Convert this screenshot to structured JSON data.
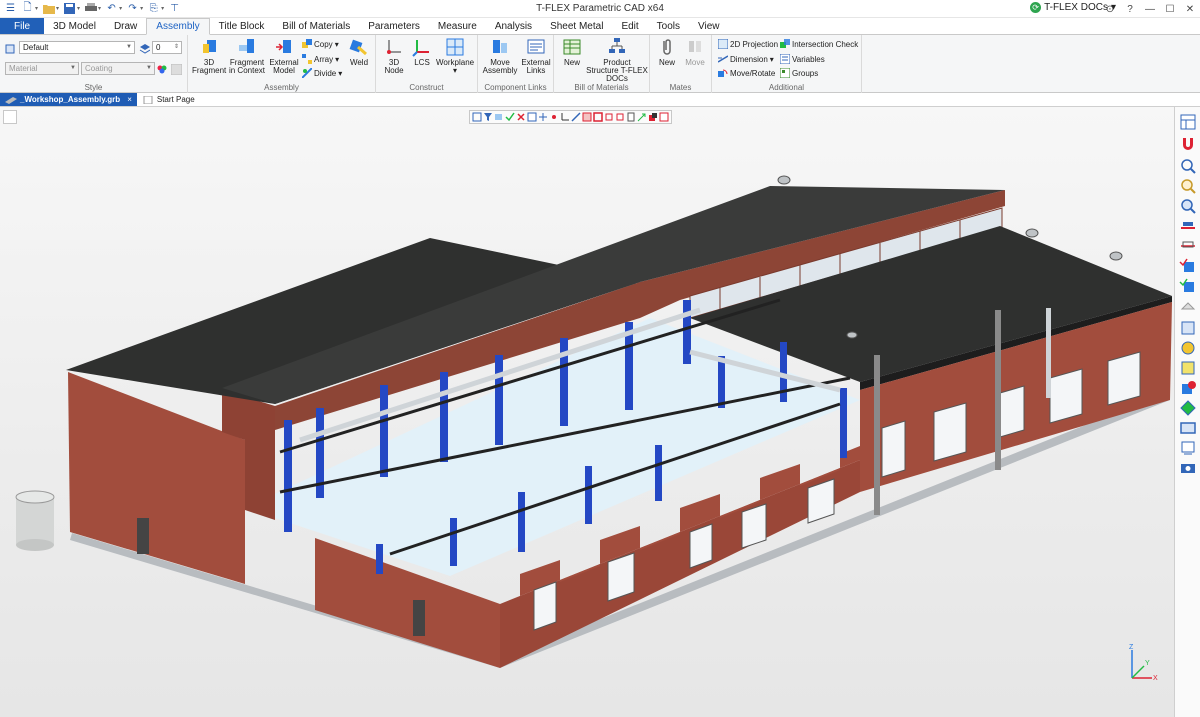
{
  "window": {
    "title": "T-FLEX Parametric CAD x64",
    "docs_label": "T-FLEX DOCs",
    "docs_dropdown": "▾"
  },
  "quick_access": [
    "menu-icon",
    "new-doc-icon",
    "open-icon",
    "save-icon",
    "print-icon",
    "undo-icon",
    "redo-icon",
    "export-icon"
  ],
  "window_buttons": {
    "minimize": "—",
    "maximize": "☐",
    "close": "✕",
    "help": "?",
    "options": "⊙"
  },
  "tabs": [
    {
      "label": "File"
    },
    {
      "label": "3D Model"
    },
    {
      "label": "Draw"
    },
    {
      "label": "Assembly"
    },
    {
      "label": "Title Block"
    },
    {
      "label": "Bill of Materials"
    },
    {
      "label": "Parameters"
    },
    {
      "label": "Measure"
    },
    {
      "label": "Analysis"
    },
    {
      "label": "Sheet Metal"
    },
    {
      "label": "Edit"
    },
    {
      "label": "Tools"
    },
    {
      "label": "View"
    }
  ],
  "ribbon": {
    "style": {
      "label": "Style",
      "style_value": "Default",
      "layer_value": "0",
      "material_placeholder": "Material",
      "coating_placeholder": "Coating"
    },
    "assembly": {
      "label": "Assembly",
      "fragment": "3D Fragment",
      "in_context": "Fragment in Context",
      "external": "External Model",
      "copy": "Copy",
      "array": "Array",
      "divide": "Divide",
      "weld": "Weld"
    },
    "construct": {
      "label": "Construct",
      "node": "3D Node",
      "lcs": "LCS",
      "workplane": "Workplane"
    },
    "component_links": {
      "label": "Component Links",
      "move_assembly": "Move Assembly",
      "external_links": "External Links"
    },
    "bom": {
      "label": "Bill of Materials",
      "new": "New",
      "product_structure": "Product Structure T-FLEX DOCs"
    },
    "mates": {
      "label": "Mates",
      "new": "New",
      "move": "Move"
    },
    "additional": {
      "label": "Additional",
      "projection": "2D Projection",
      "dimension": "Dimension",
      "move_rotate": "Move/Rotate",
      "intersection": "Intersection Check",
      "variables": "Variables",
      "groups": "Groups"
    }
  },
  "documents": [
    {
      "label": "_Workshop_Assembly.grb",
      "close": "×"
    },
    {
      "label": "Start Page"
    }
  ],
  "axes": {
    "x": "X",
    "y": "Y",
    "z": "Z"
  },
  "colors": {
    "accent": "#1f5cb4",
    "brick": "#9c4a3a",
    "roof": "#2e2f2e",
    "steel": "#2448c4",
    "floor": "#dff0f8"
  }
}
